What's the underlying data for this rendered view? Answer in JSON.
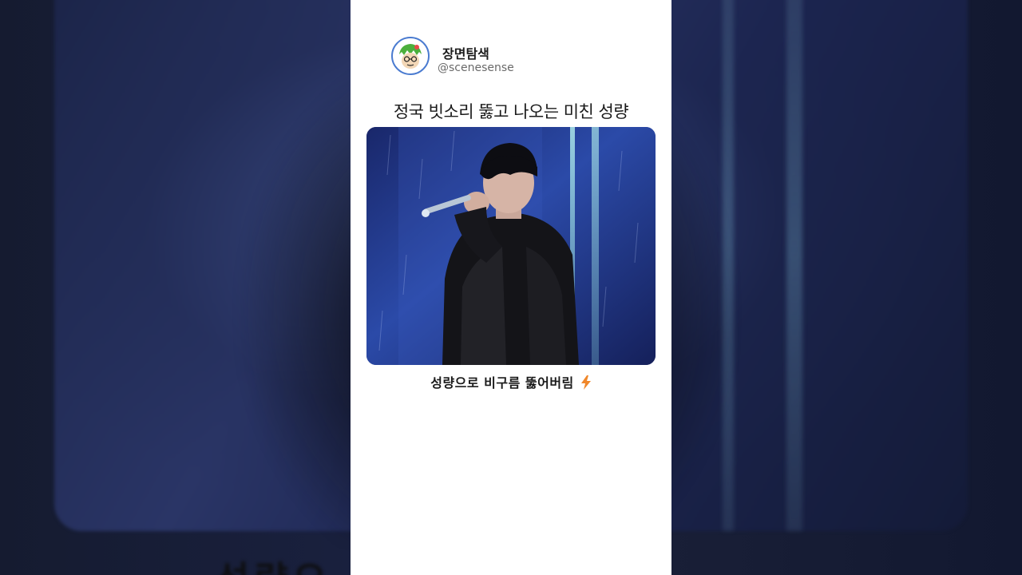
{
  "channel": {
    "name": "장면탐색",
    "handle": "@scenesense",
    "avatar_icon": "cartoon-face-avatar-icon"
  },
  "post": {
    "headline": "정국 빗소리 뚫고 나오는 미친 성량",
    "photo": "singer-performing-in-rain-photo",
    "caption": "성량으로 비구름 뚫어버림",
    "caption_icon": "lightning-bolt-icon"
  },
  "background": {
    "blurred_caption": "성량으 ... 킨"
  },
  "colors": {
    "card_bg": "#ffffff",
    "avatar_ring": "#4a7bd0",
    "bolt_orange": "#f0872a",
    "photo_blue": "#253a8c"
  }
}
